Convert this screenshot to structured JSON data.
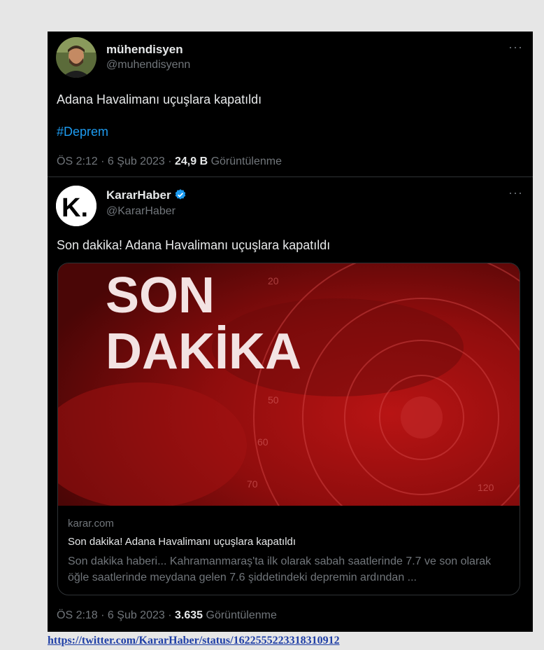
{
  "tweet1": {
    "name": "mühendisyen",
    "handle": "@muhendisyenn",
    "text": "Adana Havalimanı uçuşlara kapatıldı",
    "hashtag": "#Deprem",
    "time": "ÖS 2:12 · 6 Şub 2023 · ",
    "views_count": "24,9 B",
    "views_label": " Görüntülenme",
    "more": "···"
  },
  "tweet2": {
    "name": "KararHaber",
    "handle": "@KararHaber",
    "text": "Son dakika! Adana Havalimanı uçuşlara kapatıldı",
    "time": "ÖS 2:18 · 6 Şub 2023 · ",
    "views_count": "3.635",
    "views_label": " Görüntülenme",
    "more": "···",
    "avatar_letter": "K.",
    "card": {
      "image_line1": "SON",
      "image_line2": "DAKİKA",
      "domain": "karar.com",
      "title": "Son dakika! Adana Havalimanı uçuşlara kapatıldı",
      "description": "Son dakika haberi... Kahramanmaraş'ta ilk olarak sabah saatlerinde 7.7 ve son olarak öğle saatlerinde meydana gelen 7.6 şiddetindeki depremin ardından ..."
    }
  },
  "source_link": "https://twitter.com/KararHaber/status/1622555223318310912",
  "colors": {
    "accent": "#1d9bf0",
    "background": "#000000",
    "page": "#e6e6e6"
  }
}
